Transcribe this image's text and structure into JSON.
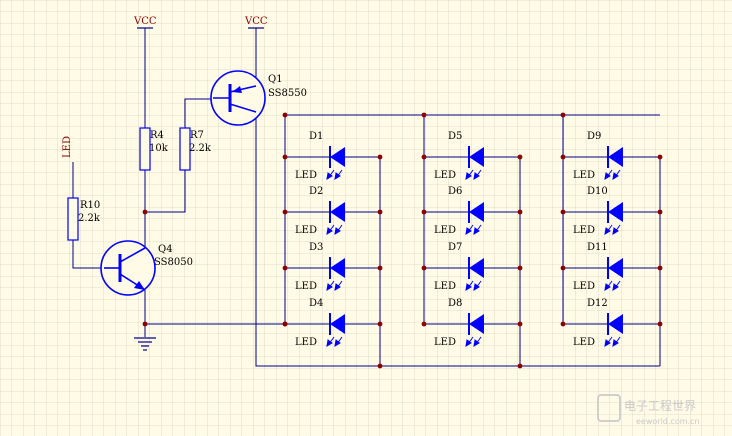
{
  "power": {
    "vcc1": "VCC",
    "vcc2": "VCC"
  },
  "input": {
    "led_label": "LED"
  },
  "resistors": {
    "r10": {
      "ref": "R10",
      "value": "2.2k"
    },
    "r4": {
      "ref": "R4",
      "value": "10k"
    },
    "r7": {
      "ref": "R7",
      "value": "2.2k"
    }
  },
  "transistors": {
    "q1": {
      "ref": "Q1",
      "part": "SS8550"
    },
    "q4": {
      "ref": "Q4",
      "part": "SS8050"
    }
  },
  "leds": [
    {
      "ref": "D1",
      "type": "LED"
    },
    {
      "ref": "D2",
      "type": "LED"
    },
    {
      "ref": "D3",
      "type": "LED"
    },
    {
      "ref": "D4",
      "type": "LED"
    },
    {
      "ref": "D5",
      "type": "LED"
    },
    {
      "ref": "D6",
      "type": "LED"
    },
    {
      "ref": "D7",
      "type": "LED"
    },
    {
      "ref": "D8",
      "type": "LED"
    },
    {
      "ref": "D9",
      "type": "LED"
    },
    {
      "ref": "D10",
      "type": "LED"
    },
    {
      "ref": "D11",
      "type": "LED"
    },
    {
      "ref": "D12",
      "type": "LED"
    }
  ],
  "watermark": {
    "text": "电子工程世界",
    "url": "eeworld.com.cn"
  },
  "colors": {
    "background": "#fffbe6",
    "grid": "#d6d6c4",
    "wire": "#00008b",
    "component": "#0000ff",
    "label": "#8b0000",
    "junction": "#8b0000"
  }
}
